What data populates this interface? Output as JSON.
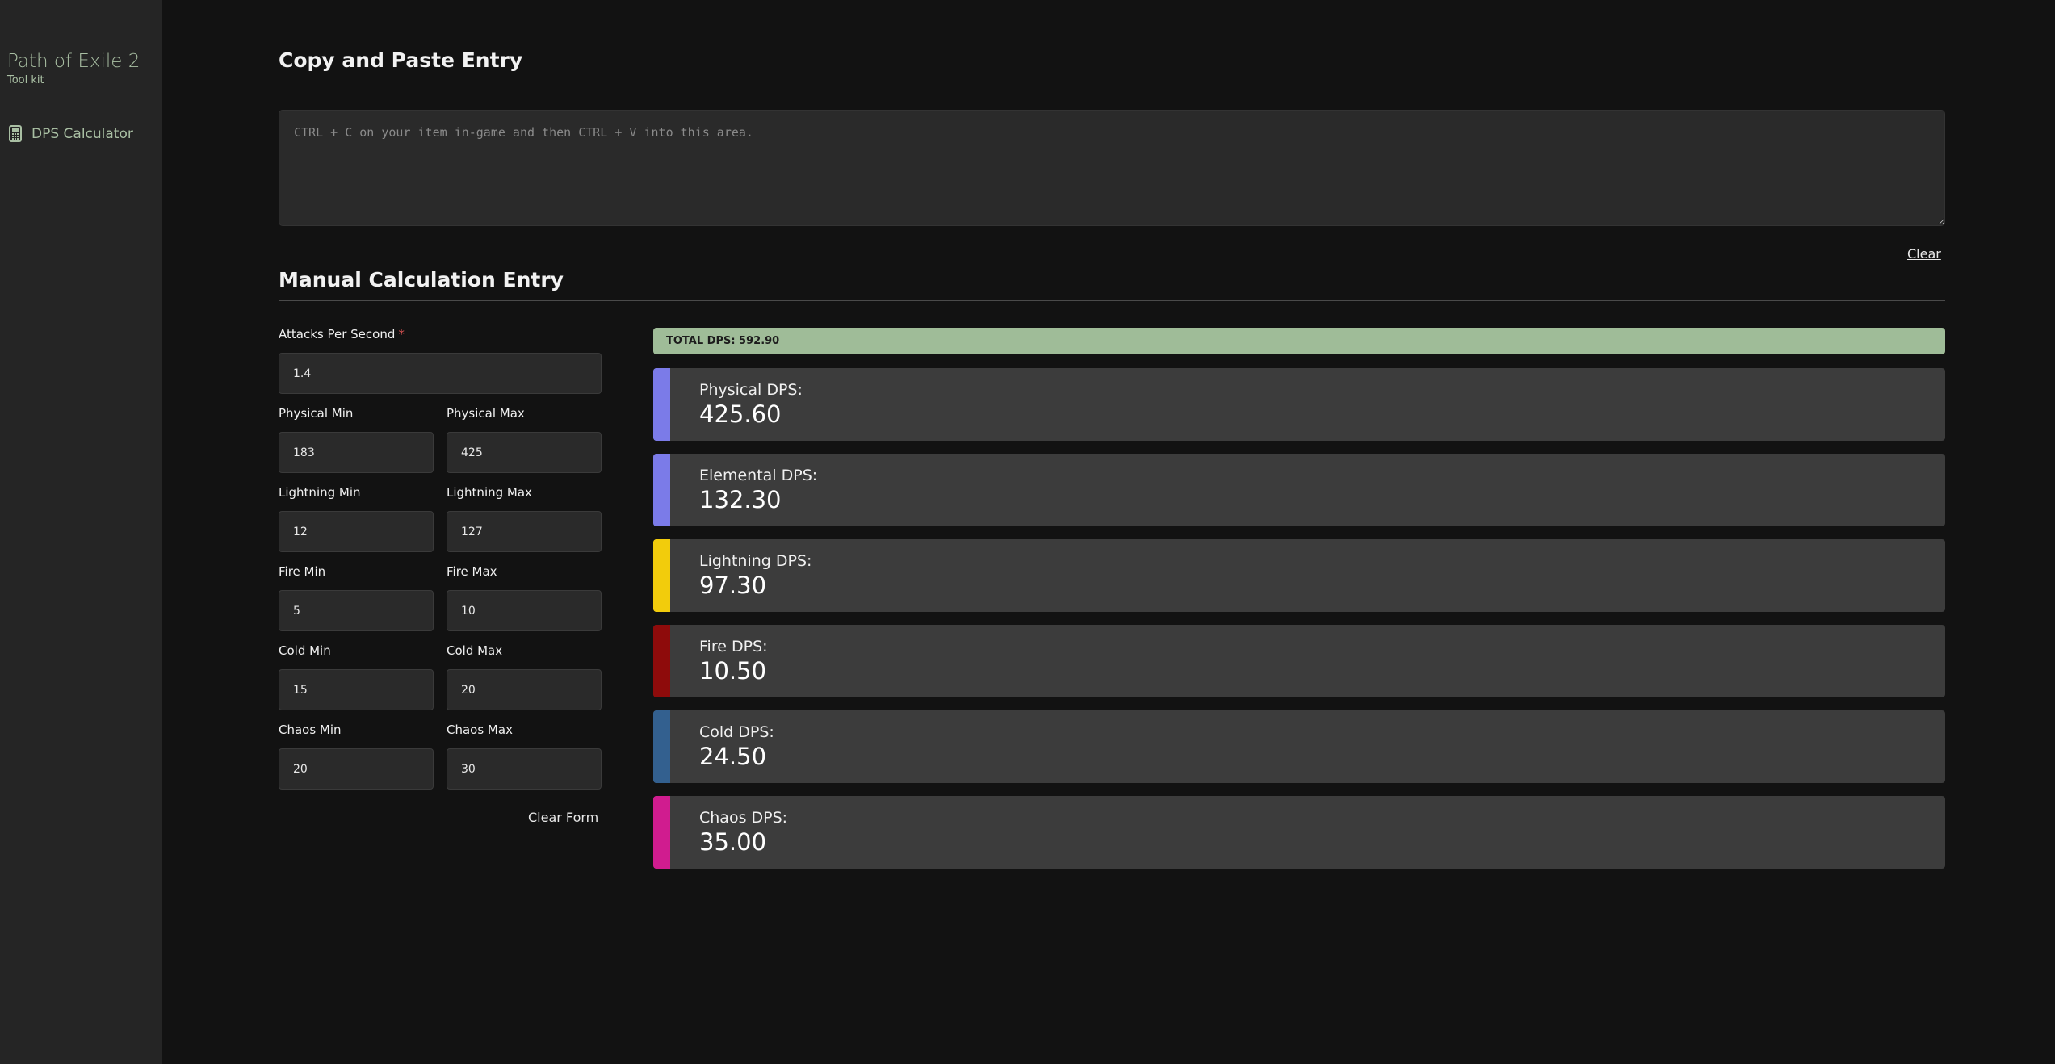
{
  "sidebar": {
    "app_title": "Path of Exile 2",
    "app_subtitle": "Tool kit",
    "nav": [
      {
        "label": "DPS Calculator",
        "icon": "calculator-icon"
      }
    ]
  },
  "paste_section": {
    "title": "Copy and Paste Entry",
    "placeholder": "CTRL + C on your item in-game and then CTRL + V into this area.",
    "value": "",
    "clear_label": "Clear"
  },
  "manual_section": {
    "title": "Manual Calculation Entry",
    "aps": {
      "label": "Attacks Per Second",
      "required_mark": "*",
      "value": "1.4"
    },
    "fields": [
      {
        "min_label": "Physical Min",
        "min_value": "183",
        "max_label": "Physical Max",
        "max_value": "425"
      },
      {
        "min_label": "Lightning Min",
        "min_value": "12",
        "max_label": "Lightning Max",
        "max_value": "127"
      },
      {
        "min_label": "Fire Min",
        "min_value": "5",
        "max_label": "Fire Max",
        "max_value": "10"
      },
      {
        "min_label": "Cold Min",
        "min_value": "15",
        "max_label": "Cold Max",
        "max_value": "20"
      },
      {
        "min_label": "Chaos Min",
        "min_value": "20",
        "max_label": "Chaos Max",
        "max_value": "30"
      }
    ],
    "clear_form_label": "Clear Form"
  },
  "results": {
    "total": "TOTAL DPS: 592.90",
    "cards": [
      {
        "label": "Physical DPS:",
        "value": "425.60",
        "color": "#7b7be8"
      },
      {
        "label": "Elemental DPS:",
        "value": "132.30",
        "color": "#7b7be8"
      },
      {
        "label": "Lightning DPS:",
        "value": "97.30",
        "color": "#f2cc0c"
      },
      {
        "label": "Fire DPS:",
        "value": "10.50",
        "color": "#8e0b0b"
      },
      {
        "label": "Cold DPS:",
        "value": "24.50",
        "color": "#33608f"
      },
      {
        "label": "Chaos DPS:",
        "value": "35.00",
        "color": "#d01c8f"
      }
    ]
  },
  "colors": {
    "accent_green": "#a9bfa3",
    "total_bar": "#9fbc98",
    "background": "#121212",
    "sidebar": "#252525"
  }
}
